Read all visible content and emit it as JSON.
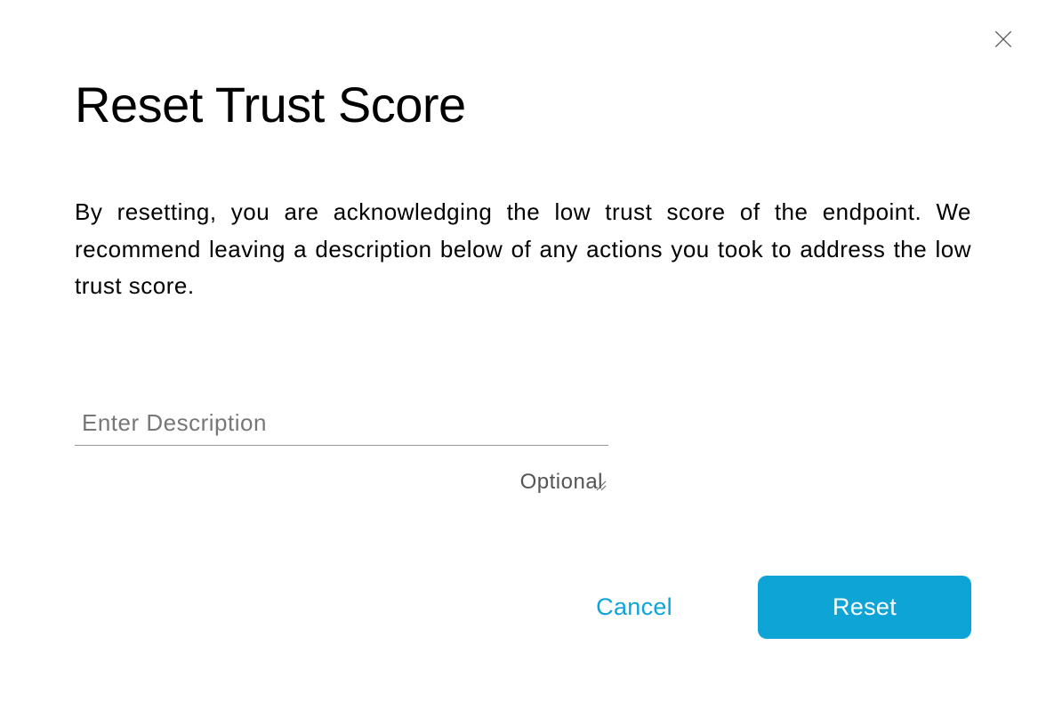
{
  "dialog": {
    "title": "Reset Trust Score",
    "description": "By resetting, you are acknowledging the low trust score of the endpoint. We recommend leaving a description below of any actions you took to address the low trust score."
  },
  "input": {
    "placeholder": "Enter Description",
    "helper": "Optional",
    "value": ""
  },
  "buttons": {
    "cancel": "Cancel",
    "reset": "Reset"
  }
}
